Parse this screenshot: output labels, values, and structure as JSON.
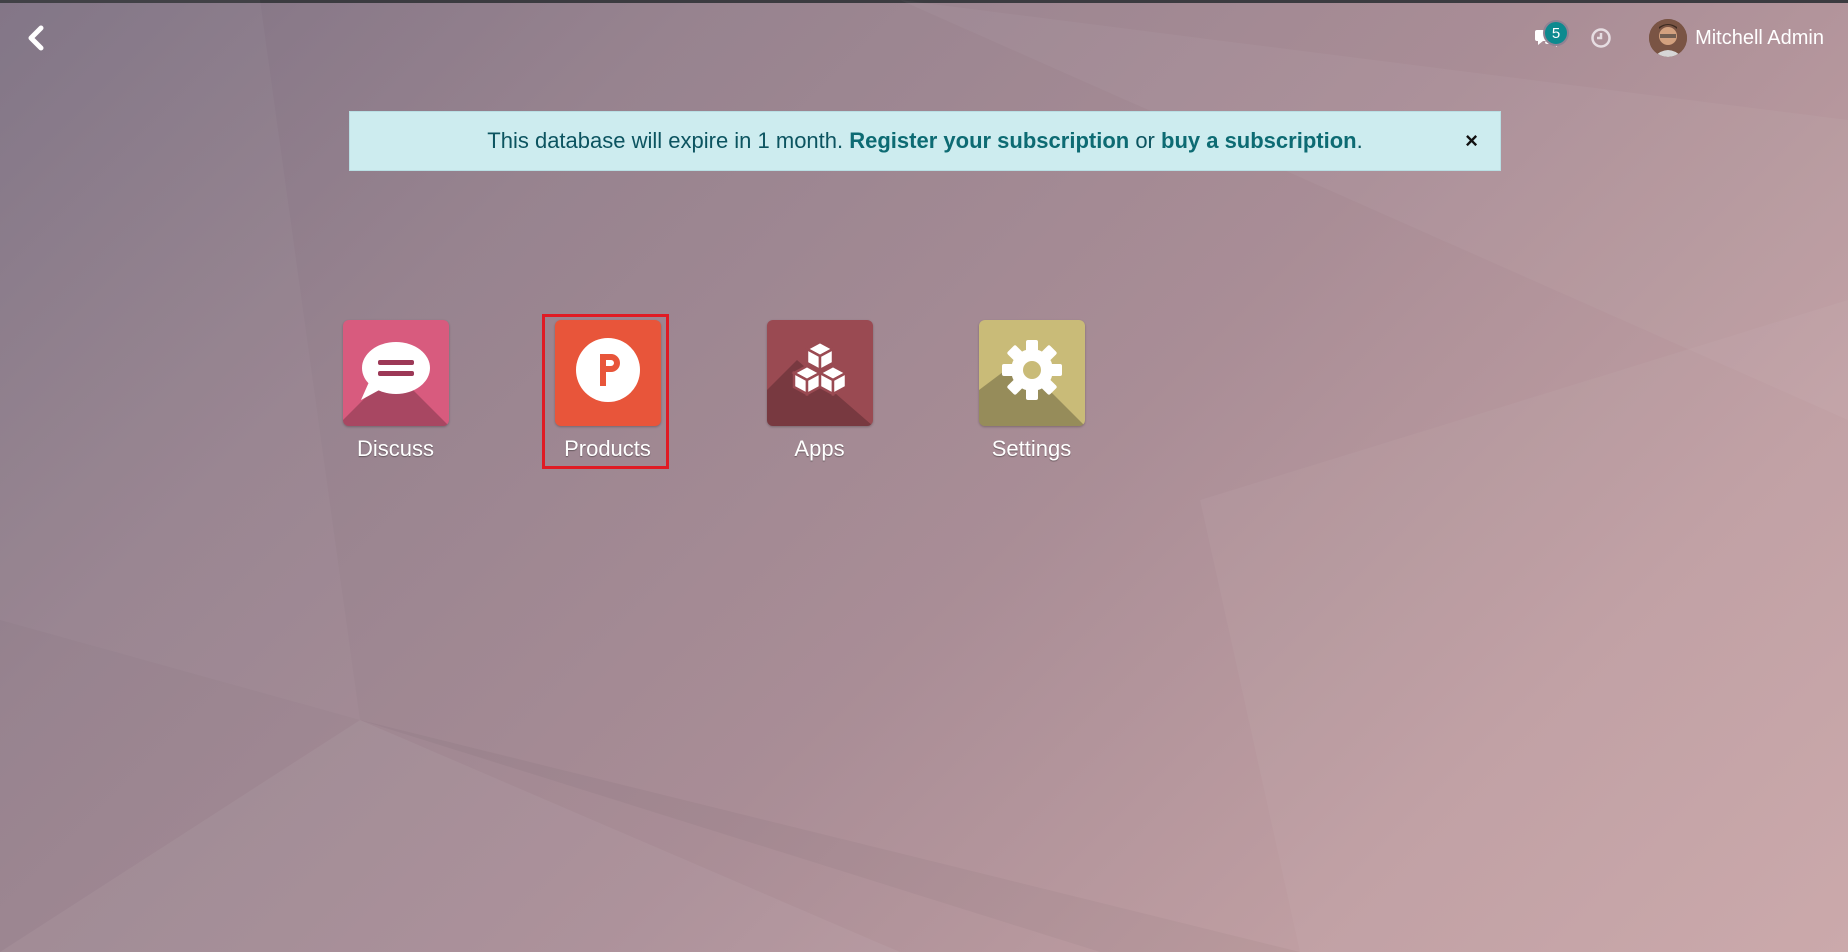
{
  "topbar": {
    "back_icon": "chevron-left-icon",
    "chat_icon": "comments-icon",
    "chat_badge": "5",
    "clock_icon": "clock-icon",
    "user_name": "Mitchell Admin"
  },
  "alert": {
    "text_prefix": "This database will expire in 1 month. ",
    "register_link": "Register your subscription",
    "middle": " or ",
    "buy_link": "buy a subscription",
    "suffix": ".",
    "close": "×"
  },
  "apps": [
    {
      "label": "Discuss",
      "icon": "discuss-icon",
      "color": "#d85b7e"
    },
    {
      "label": "Products",
      "icon": "products-icon",
      "color": "#e8553a"
    },
    {
      "label": "Apps",
      "icon": "apps-cubes-icon",
      "color": "#9a4a52"
    },
    {
      "label": "Settings",
      "icon": "gear-icon",
      "color": "#c9bb78"
    }
  ],
  "colors": {
    "alert_bg": "#cdecef",
    "alert_text": "#0c5460",
    "badge": "#0d8a8f",
    "selection": "#e01b24"
  }
}
